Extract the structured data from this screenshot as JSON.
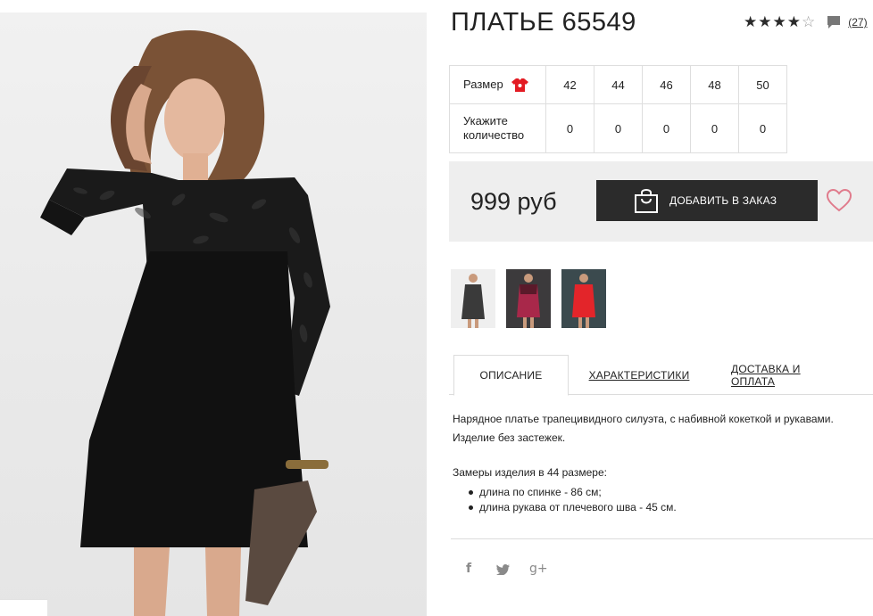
{
  "product": {
    "title": "ПЛАТЬЕ 65549",
    "rating_stars": 4,
    "rating_max": 5,
    "review_count": "(27)"
  },
  "sizes": {
    "size_label": "Размер",
    "qty_label_line1": "Укажите",
    "qty_label_line2": "количество",
    "values": [
      "42",
      "44",
      "46",
      "48",
      "50"
    ],
    "quantities": [
      "0",
      "0",
      "0",
      "0",
      "0"
    ]
  },
  "purchase": {
    "price": "999 руб",
    "order_button_label": "ДОБАВИТЬ В ЗАКАЗ"
  },
  "tabs": [
    "ОПИСАНИЕ",
    "ХАРАКТЕРИСТИКИ",
    "ДОСТАВКА И ОПЛАТА"
  ],
  "description": {
    "text": "Нарядное платье трапецивидного силуэта, с набивной кокеткой и рукавами. Изделие без застежек.",
    "measurements_title": "Замеры изделия в 44 размере:",
    "measurements": [
      "длина по спинке - 86 см;",
      "длина рукава от плечевого шва - 45 см."
    ]
  },
  "social": {
    "facebook": "f",
    "twitter": "🐦",
    "google_plus": "g+"
  },
  "icons": [
    "star-icon",
    "comment-icon",
    "tshirt-icon",
    "shopping-bag-icon",
    "heart-icon",
    "facebook-icon",
    "twitter-icon",
    "google-plus-icon"
  ],
  "colors": {
    "accent_red": "#e31b23",
    "button_dark": "#2b2b2b",
    "price_bg": "#eeeeee",
    "heart_pink": "#e07b8c",
    "thumb_colors": [
      "#3a3a3a",
      "#a8284a",
      "#e3252a"
    ]
  }
}
